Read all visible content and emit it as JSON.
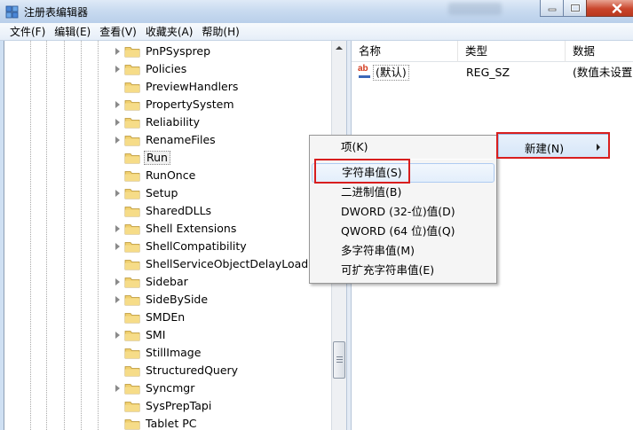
{
  "window": {
    "title": "注册表编辑器",
    "controls": [
      "minimize-icon",
      "maximize-icon",
      "close-icon"
    ]
  },
  "menubar": [
    "文件(F)",
    "编辑(E)",
    "查看(V)",
    "收藏夹(A)",
    "帮助(H)"
  ],
  "tree": {
    "items": [
      {
        "label": "PnPSysprep",
        "expandable": true
      },
      {
        "label": "Policies",
        "expandable": true
      },
      {
        "label": "PreviewHandlers",
        "expandable": false
      },
      {
        "label": "PropertySystem",
        "expandable": true
      },
      {
        "label": "Reliability",
        "expandable": true
      },
      {
        "label": "RenameFiles",
        "expandable": true
      },
      {
        "label": "Run",
        "expandable": false,
        "selected": true
      },
      {
        "label": "RunOnce",
        "expandable": false
      },
      {
        "label": "Setup",
        "expandable": true
      },
      {
        "label": "SharedDLLs",
        "expandable": false
      },
      {
        "label": "Shell Extensions",
        "expandable": true
      },
      {
        "label": "ShellCompatibility",
        "expandable": true
      },
      {
        "label": "ShellServiceObjectDelayLoad",
        "expandable": false
      },
      {
        "label": "Sidebar",
        "expandable": true
      },
      {
        "label": "SideBySide",
        "expandable": true
      },
      {
        "label": "SMDEn",
        "expandable": false
      },
      {
        "label": "SMI",
        "expandable": true
      },
      {
        "label": "StillImage",
        "expandable": false
      },
      {
        "label": "StructuredQuery",
        "expandable": false
      },
      {
        "label": "Syncmgr",
        "expandable": true
      },
      {
        "label": "SysPrepTapi",
        "expandable": false
      },
      {
        "label": "Tablet PC",
        "expandable": false
      }
    ]
  },
  "values_list": {
    "columns": [
      "名称",
      "类型",
      "数据"
    ],
    "rows": [
      {
        "icon": "string-value-icon",
        "name": "(默认)",
        "type": "REG_SZ",
        "data": "(数值未设置"
      }
    ]
  },
  "context_menu": {
    "items": [
      "项(K)",
      "字符串值(S)",
      "二进制值(B)",
      "DWORD (32-位)值(D)",
      "QWORD (64 位)值(Q)",
      "多字符串值(M)",
      "可扩充字符串值(E)"
    ],
    "highlighted": "字符串值(S)"
  },
  "parent_menu": {
    "label": "新建(N)"
  },
  "colors": {
    "title_bar": "#c9dbf0",
    "folder": "#e8c35a",
    "close_button": "#c9452c",
    "highlight_box": "#d81e1e",
    "selection": "#e3eefb"
  }
}
